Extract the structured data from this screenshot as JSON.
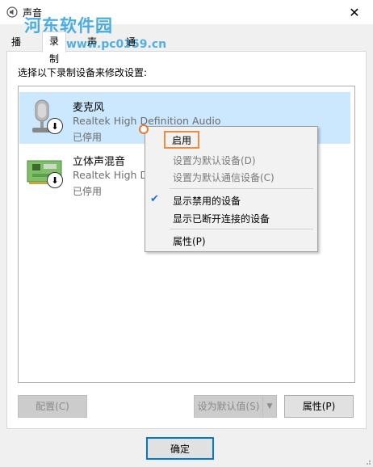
{
  "window": {
    "title": "声音",
    "close_glyph": "✕"
  },
  "watermark": {
    "text": "河东软件园",
    "url": "www.pc0359.cn"
  },
  "tabs": [
    {
      "label": "播放"
    },
    {
      "label": "录制"
    },
    {
      "label": "声音"
    },
    {
      "label": "通信"
    }
  ],
  "instruction": "选择以下录制设备来修改设置:",
  "devices": [
    {
      "name": "麦克风",
      "subtitle": "Realtek High Definition Audio",
      "status": "已停用",
      "icon": "microphone-icon",
      "selected": true
    },
    {
      "name": "立体声混音",
      "subtitle": "Realtek High De",
      "status": "已停用",
      "icon": "circuit-board-icon",
      "selected": false
    }
  ],
  "context_menu": {
    "items": [
      {
        "label": "启用",
        "enabled": true,
        "highlight": true
      },
      {
        "label": "设置为默认设备(D)",
        "enabled": false
      },
      {
        "label": "设置为默认通信设备(C)",
        "enabled": false
      },
      {
        "label": "显示禁用的设备",
        "enabled": true,
        "checked": true
      },
      {
        "label": "显示已断开连接的设备",
        "enabled": true
      },
      {
        "label": "属性(P)",
        "enabled": true
      }
    ],
    "check_glyph": "✔"
  },
  "buttons": {
    "configure": "配置(C)",
    "set_default": "设为默认值(S)",
    "split_arrow": "▼",
    "properties": "属性(P)",
    "ok": "确定"
  },
  "colors": {
    "selection": "#cce8ff",
    "highlight_box": "#f08a3c",
    "accent": "#0078d7"
  }
}
